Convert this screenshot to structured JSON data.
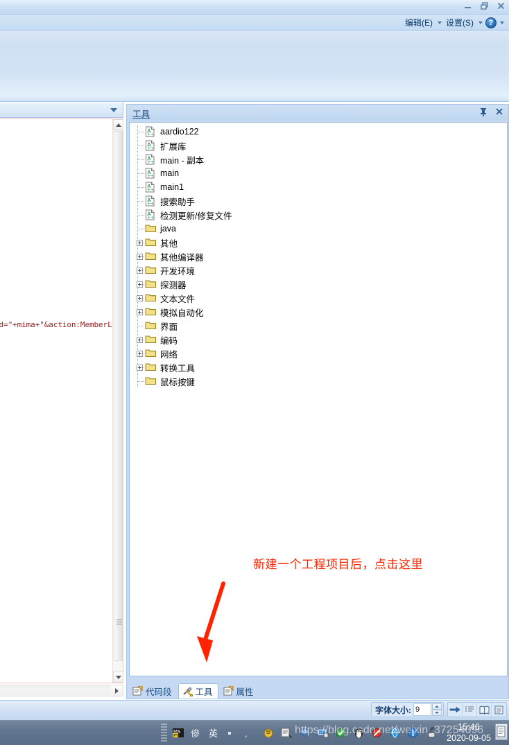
{
  "window": {
    "controls": [
      {
        "name": "minimize",
        "glyph": "minimize-icon"
      },
      {
        "name": "restore",
        "glyph": "restore-icon"
      },
      {
        "name": "close",
        "glyph": "close-icon"
      }
    ]
  },
  "menubar": {
    "items": [
      {
        "label": "编辑(E)",
        "mnemonic": "E",
        "text": "编辑",
        "suffix": "(E)"
      },
      {
        "label": "设置(S)",
        "mnemonic": "S",
        "text": "设置",
        "suffix": "(S)"
      }
    ],
    "help_glyph": "?"
  },
  "left_pane": {
    "combo_value": "",
    "code_line": "rd=\"+mima+\"&action:MemberL"
  },
  "dock_panel": {
    "title": "工具",
    "pin_icon": "pin-icon",
    "close_icon": "close-icon",
    "tree": [
      {
        "label": "aardio122",
        "type": "file",
        "expandable": false,
        "indent": 1
      },
      {
        "label": "扩展库",
        "type": "file",
        "expandable": false,
        "indent": 1
      },
      {
        "label": "main - 副本",
        "type": "file",
        "expandable": false,
        "indent": 1
      },
      {
        "label": "main",
        "type": "file",
        "expandable": false,
        "indent": 1
      },
      {
        "label": "main1",
        "type": "file",
        "expandable": false,
        "indent": 1
      },
      {
        "label": "搜索助手",
        "type": "file",
        "expandable": false,
        "indent": 1
      },
      {
        "label": "检测更新/修复文件",
        "type": "file",
        "expandable": false,
        "indent": 1
      },
      {
        "label": "java",
        "type": "folder",
        "expandable": false,
        "indent": 1
      },
      {
        "label": "其他",
        "type": "folder",
        "expandable": true,
        "indent": 1
      },
      {
        "label": "其他编译器",
        "type": "folder",
        "expandable": true,
        "indent": 1
      },
      {
        "label": "开发环境",
        "type": "folder",
        "expandable": true,
        "indent": 1
      },
      {
        "label": "探测器",
        "type": "folder",
        "expandable": true,
        "indent": 1
      },
      {
        "label": "文本文件",
        "type": "folder",
        "expandable": true,
        "indent": 1
      },
      {
        "label": "模拟自动化",
        "type": "folder",
        "expandable": true,
        "indent": 1
      },
      {
        "label": "界面",
        "type": "folder",
        "expandable": false,
        "indent": 1
      },
      {
        "label": "编码",
        "type": "folder",
        "expandable": true,
        "indent": 1
      },
      {
        "label": "网络",
        "type": "folder",
        "expandable": true,
        "indent": 1
      },
      {
        "label": "转换工具",
        "type": "folder",
        "expandable": true,
        "indent": 1
      },
      {
        "label": "鼠标按键",
        "type": "folder",
        "expandable": false,
        "indent": 1
      }
    ]
  },
  "annotation": {
    "text": "新建一个工程项目后，点击这里",
    "color": "#ff2400",
    "arrow": "red-arrow-down-left"
  },
  "tabs": [
    {
      "label": "代码段",
      "icon": "snippet-icon",
      "active": false
    },
    {
      "label": "工具",
      "icon": "tools-icon",
      "active": true
    },
    {
      "label": "属性",
      "icon": "properties-icon",
      "active": false
    }
  ],
  "statusbar": {
    "fontsize_label": "字体大小:",
    "fontsize_value": "9",
    "icons": [
      {
        "name": "arrow-right-icon"
      },
      {
        "name": "list-icon"
      },
      {
        "name": "book-icon"
      },
      {
        "name": "document-icon"
      }
    ]
  },
  "taskbar": {
    "time": "15:46",
    "date": "2020-09-05",
    "tray_icons": [
      "ms-pinyin-icon",
      "ime-pen-icon",
      "ime-chinese-icon",
      "ime-dot-icon",
      "ime-comma-icon",
      "ime-keyboard-icon",
      "ime-tool-icon",
      "app-box-icon",
      "app-monitor-icon",
      "app-green-icon",
      "qq-penguin-icon",
      "block-icon",
      "browser-icon",
      "info-icon",
      "network-icon"
    ]
  },
  "watermark": {
    "text": "https://blog.csdn.net/weixin_37254096"
  },
  "colors": {
    "accent": "#1f4b82",
    "annotation": "#ff2400",
    "panel_bg": "#c5daf2",
    "taskbar": "#61748d"
  }
}
